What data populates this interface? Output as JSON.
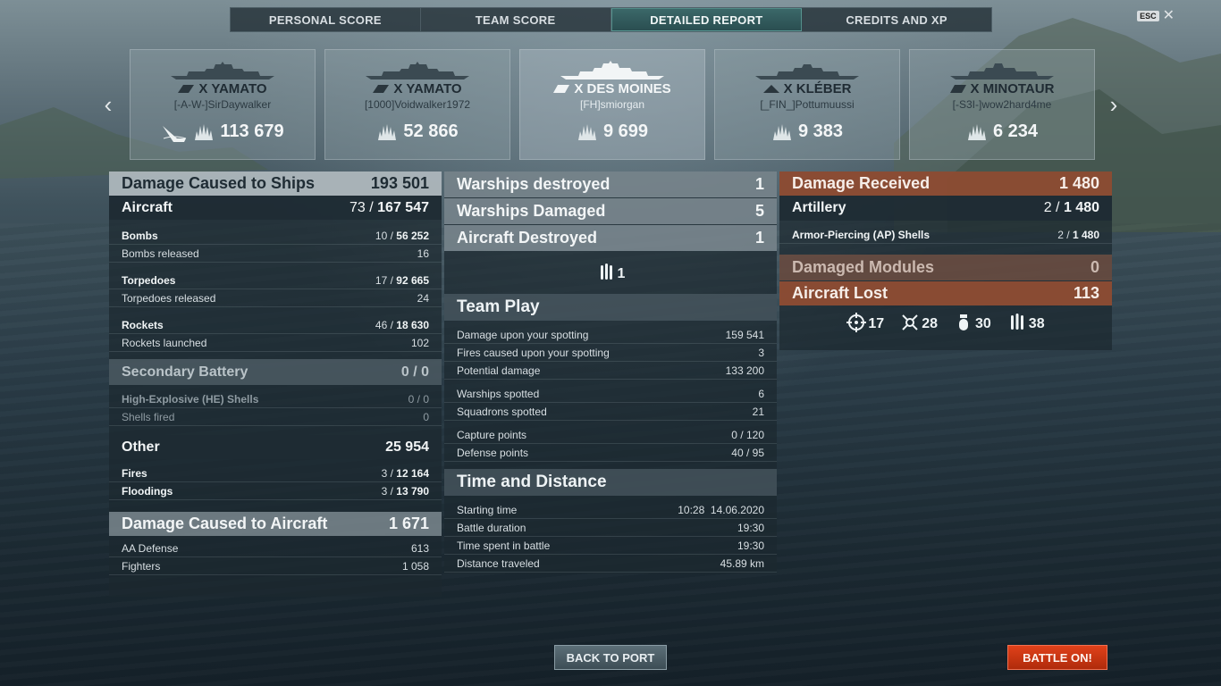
{
  "tabs": [
    {
      "label": "PERSONAL SCORE"
    },
    {
      "label": "TEAM SCORE"
    },
    {
      "label": "DETAILED REPORT"
    },
    {
      "label": "CREDITS AND XP"
    }
  ],
  "esc": {
    "key": "ESC",
    "close": "✕"
  },
  "cards": [
    {
      "ship": "X YAMATO",
      "player": "[-A-W-]SirDaywalker",
      "score": "113 679"
    },
    {
      "ship": "X YAMATO",
      "player": "[1000]Voidwalker1972",
      "score": "52 866"
    },
    {
      "ship": "X DES MOINES",
      "player": "[FH]smiorgan",
      "score": "9 699"
    },
    {
      "ship": "X KLÉBER",
      "player": "[_FIN_]Pottumuussi",
      "score": "9 383"
    },
    {
      "ship": "X MINOTAUR",
      "player": "[-S3I-]wow2hard4me",
      "score": "6 234"
    }
  ],
  "left": {
    "damage_ships": {
      "label": "Damage Caused to Ships",
      "value": "193 501"
    },
    "aircraft": {
      "label": "Aircraft",
      "a": "73",
      "b": "167 547"
    },
    "bombs": {
      "label": "Bombs",
      "a": "10",
      "b": "56 252"
    },
    "bombs_released": {
      "label": "Bombs released",
      "value": "16"
    },
    "torpedoes": {
      "label": "Torpedoes",
      "a": "17",
      "b": "92 665"
    },
    "torpedoes_released": {
      "label": "Torpedoes released",
      "value": "24"
    },
    "rockets": {
      "label": "Rockets",
      "a": "46",
      "b": "18 630"
    },
    "rockets_launched": {
      "label": "Rockets launched",
      "value": "102"
    },
    "secondary": {
      "label": "Secondary Battery",
      "value": "0 / 0"
    },
    "he_shells": {
      "label": "High-Explosive (HE) Shells",
      "value": "0 / 0"
    },
    "shells_fired": {
      "label": "Shells fired",
      "value": "0"
    },
    "other": {
      "label": "Other",
      "value": "25 954"
    },
    "fires": {
      "label": "Fires",
      "a": "3",
      "b": "12 164"
    },
    "floodings": {
      "label": "Floodings",
      "a": "3",
      "b": "13 790"
    },
    "damage_aircraft": {
      "label": "Damage Caused to Aircraft",
      "value": "1 671"
    },
    "aa_defense": {
      "label": "AA Defense",
      "value": "613"
    },
    "fighters": {
      "label": "Fighters",
      "value": "1 058"
    }
  },
  "middle": {
    "warships_destroyed": {
      "label": "Warships destroyed",
      "value": "1"
    },
    "warships_damaged": {
      "label": "Warships Damaged",
      "value": "5"
    },
    "aircraft_destroyed": {
      "label": "Aircraft Destroyed",
      "value": "1"
    },
    "shells_icon_count": "1",
    "team_play": {
      "title": "Team Play"
    },
    "team_rows": [
      {
        "label": "Damage upon your spotting",
        "value": "159 541"
      },
      {
        "label": "Fires caused upon your spotting",
        "value": "3"
      },
      {
        "label": "Potential damage",
        "value": "133 200"
      },
      {
        "label": "Warships spotted",
        "value": "6"
      },
      {
        "label": "Squadrons spotted",
        "value": "21"
      },
      {
        "label": "Capture points",
        "value": "0 / 120"
      },
      {
        "label": "Defense points",
        "value": "40 / 95"
      }
    ],
    "time_distance": {
      "title": "Time and Distance"
    },
    "time_rows": [
      {
        "label": "Starting time",
        "value": "10:28  14.06.2020"
      },
      {
        "label": "Battle duration",
        "value": "19:30"
      },
      {
        "label": "Time spent in battle",
        "value": "19:30"
      },
      {
        "label": "Distance traveled",
        "value": "45.89 km"
      }
    ]
  },
  "right": {
    "damage_received": {
      "label": "Damage Received",
      "value": "1 480"
    },
    "artillery": {
      "label": "Artillery",
      "a": "2",
      "b": "1 480"
    },
    "ap_shells": {
      "label": "Armor-Piercing (AP) Shells",
      "a": "2",
      "b": "1 480"
    },
    "damaged_modules": {
      "label": "Damaged Modules",
      "value": "0"
    },
    "aircraft_lost": {
      "label": "Aircraft Lost",
      "value": "113"
    },
    "icons": [
      {
        "name": "crosshair-icon",
        "value": "17"
      },
      {
        "name": "plane-shot-icon",
        "value": "28"
      },
      {
        "name": "bomb-icon",
        "value": "30"
      },
      {
        "name": "torpedo-icon",
        "value": "38"
      }
    ]
  },
  "buttons": {
    "back_to_port": "BACK TO PORT",
    "battle_on": "BATTLE ON!"
  }
}
